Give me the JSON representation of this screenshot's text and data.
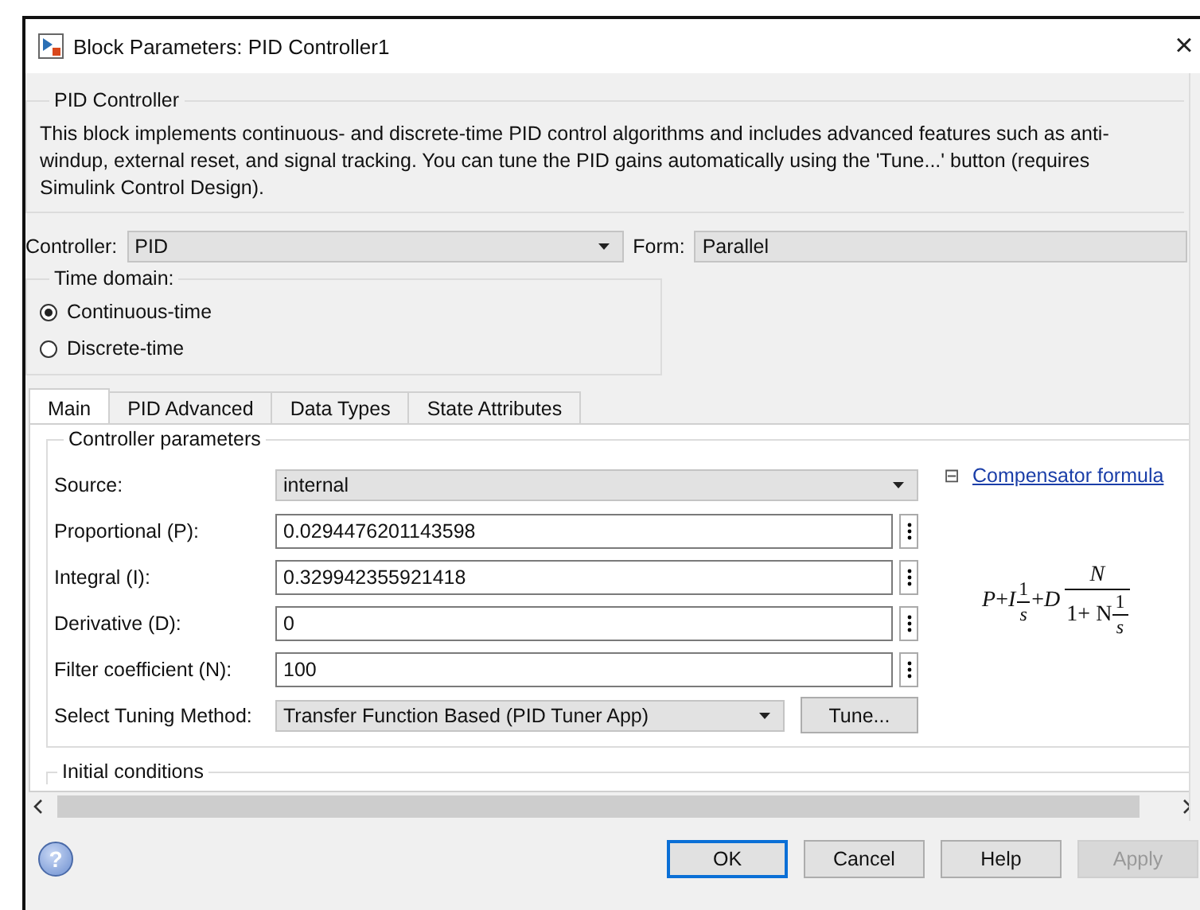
{
  "window": {
    "title": "Block Parameters: PID Controller1",
    "close": "×"
  },
  "description": {
    "title": "PID Controller",
    "text": "This block implements continuous- and discrete-time PID control algorithms and includes advanced features such as anti-windup, external reset, and signal tracking. You can tune the PID gains automatically using the 'Tune...' button (requires Simulink Control Design)."
  },
  "controller": {
    "label": "Controller:",
    "value": "PID"
  },
  "form": {
    "label": "Form:",
    "value": "Parallel"
  },
  "time_domain": {
    "title": "Time domain:",
    "options": [
      {
        "label": "Continuous-time",
        "selected": true
      },
      {
        "label": "Discrete-time",
        "selected": false
      }
    ]
  },
  "tabs": [
    {
      "label": "Main",
      "selected": true
    },
    {
      "label": "PID Advanced",
      "selected": false
    },
    {
      "label": "Data Types",
      "selected": false
    },
    {
      "label": "State Attributes",
      "selected": false
    }
  ],
  "controller_parameters": {
    "title": "Controller parameters",
    "rows": [
      {
        "kind": "dropdown",
        "label": "Source:",
        "value": "internal"
      },
      {
        "kind": "field",
        "label": "Proportional (P):",
        "value": "0.0294476201143598"
      },
      {
        "kind": "field",
        "label": "Integral (I):",
        "value": "0.329942355921418"
      },
      {
        "kind": "field",
        "label": "Derivative (D):",
        "value": "0"
      },
      {
        "kind": "field",
        "label": "Filter coefficient (N):",
        "value": "100"
      },
      {
        "kind": "tuning",
        "label": "Select Tuning Method:",
        "value": "Transfer Function Based (PID Tuner App)",
        "button": "Tune..."
      }
    ],
    "formula_link": "Compensator formula",
    "collapse": "⊟",
    "formula": {
      "a": "P",
      "plus1": "+",
      "b": "I",
      "n1": "1",
      "d1": "s",
      "plus2": "+",
      "c": "D",
      "n2": "N",
      "den": "1+ N",
      "n3": "1",
      "d3": "s"
    }
  },
  "initial_conditions": {
    "title": "Initial conditions"
  },
  "buttons": [
    {
      "label": "OK",
      "selected": true,
      "disabled": false
    },
    {
      "label": "Cancel",
      "selected": false,
      "disabled": false
    },
    {
      "label": "Help",
      "selected": false,
      "disabled": false
    },
    {
      "label": "Apply",
      "selected": false,
      "disabled": true
    }
  ],
  "help_icon": "?"
}
